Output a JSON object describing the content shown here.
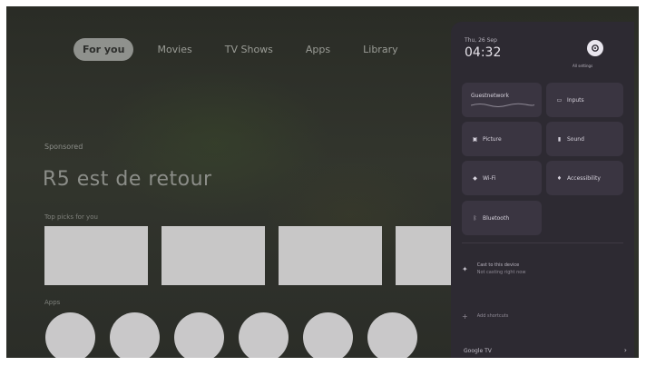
{
  "nav": {
    "tabs": [
      {
        "label": "For you",
        "active": true
      },
      {
        "label": "Movies",
        "active": false
      },
      {
        "label": "TV Shows",
        "active": false
      },
      {
        "label": "Apps",
        "active": false
      },
      {
        "label": "Library",
        "active": false
      }
    ]
  },
  "hero": {
    "eyebrow": "Sponsored",
    "title": "R5 est de retour"
  },
  "rows": {
    "first_label": "Top picks for you",
    "second_label": "Apps"
  },
  "quick_settings": {
    "date": "Thu, 26 Sep",
    "time": "04:32",
    "account_label": "All settings",
    "tiles": {
      "network": "Guestnetwork",
      "inputs": "Inputs",
      "picture": "Picture",
      "sound": "Sound",
      "wifi": "Wi-Fi",
      "accessibility": "Accessibility",
      "bluetooth": "Bluetooth"
    },
    "media_line1": "Cast to this device",
    "media_line2": "Not casting right now",
    "add_label": "Add shortcuts",
    "footer": "Google TV"
  },
  "colors": {
    "panel": "#2d2a32",
    "tile": "#3a3541",
    "placeholder": "#c8c7c7"
  }
}
